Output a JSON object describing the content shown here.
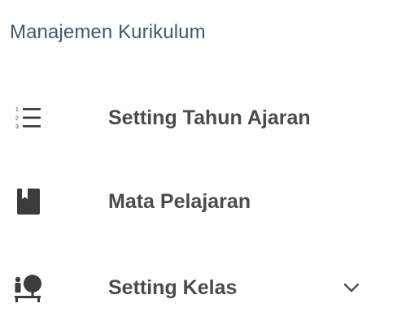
{
  "section": {
    "title": "Manajemen Kurikulum"
  },
  "items": [
    {
      "label": "Setting Tahun Ajaran",
      "icon": "numbered-list-icon"
    },
    {
      "label": "Mata Pelajaran",
      "icon": "book-icon"
    },
    {
      "label": "Setting Kelas",
      "icon": "class-person-icon",
      "expandable": true,
      "expand_icon": "chevron-down-icon"
    }
  ],
  "colors": {
    "header_text": "#3f5a6e",
    "item_text": "#4b4b4b",
    "icon": "#3c3c3c",
    "background": "#ffffff"
  }
}
